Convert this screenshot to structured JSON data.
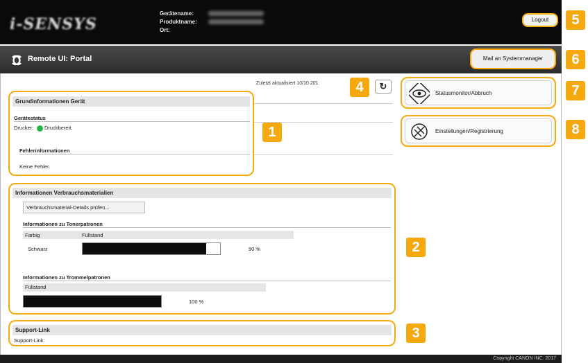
{
  "header": {
    "logo": "i-SENSYS",
    "device_name_label": "Gerätename:",
    "product_name_label": "Produktname:",
    "location_label": "Ort:",
    "logout_label": "Logout"
  },
  "portal": {
    "title": "Remote UI: Portal",
    "mail_button": "Mail an Systemmanager"
  },
  "status": {
    "updated_text": "Zuletzt aktualisiert 10/10 201"
  },
  "side_buttons": {
    "status_monitor": "Statusmonitor/Abbruch",
    "settings": "Einstellungen/Registrierung"
  },
  "basic_info": {
    "title": "Grundinformationen Gerät",
    "device_status_heading": "Gerätestatus",
    "printer_label": "Drucker:",
    "printer_status": "Druckbereit.",
    "error_heading": "Fehlerinformationen",
    "error_value": "Keine Fehler."
  },
  "consumables": {
    "title": "Informationen Verbrauchsmaterialien",
    "details_button": "Verbrauchsmaterial-Details prüfen...",
    "toner_heading": "Informationen zu Tonerpatronen",
    "toner_col_color": "Farbig",
    "toner_col_level": "Füllstand",
    "toner_row_color": "Schwarz",
    "toner_level_text": "90 %",
    "toner_level": 0.9,
    "drum_heading": "Informationen zu Trommelpatronen",
    "drum_col_level": "Füllstand",
    "drum_level_text": "100 %",
    "drum_level": 1.0
  },
  "support": {
    "title": "Support-Link",
    "label": "Support-Link:"
  },
  "footer": {
    "copyright": "Copyright CANON INC. 2017"
  },
  "badges": [
    "1",
    "2",
    "3",
    "4",
    "5",
    "6",
    "7",
    "8"
  ],
  "colors": {
    "highlight": "#f5a90f",
    "status_green": "#29b34b"
  }
}
